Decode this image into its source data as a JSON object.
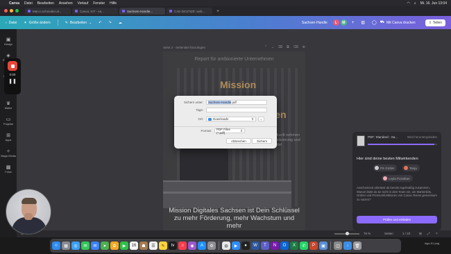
{
  "menubar": {
    "app": "Canva",
    "menus": [
      "Datei",
      "Bearbeiten",
      "Ansehen",
      "Verlauf",
      "Fenster",
      "Hilfe"
    ],
    "clock": "Mi. 16. Jun 13:04"
  },
  "tabs": [
    {
      "label": "Marco.schneider.al..."
    },
    {
      "label": "Canva: KIT - sa..."
    },
    {
      "label": "Sachsen-Handle..."
    },
    {
      "label": "CAE-DIGITIZE: web..."
    }
  ],
  "header": {
    "home": "Datei",
    "resize": "Größe ändern",
    "edit": "Bearbeiten",
    "doc_title": "Sachsen-Handle",
    "avatars": [
      {
        "letter": "L",
        "color": "#e85a7c"
      },
      {
        "letter": "M",
        "color": "#52b788"
      }
    ],
    "print": "Mit Canva drucken",
    "share": "Teilen"
  },
  "sidebar": {
    "items": [
      {
        "icon": "design-icon",
        "label": "Design"
      },
      {
        "icon": "elements-icon",
        "label": "Elemente"
      },
      {
        "icon": "upload-icon",
        "label": "Uploads"
      },
      {
        "icon": "text-icon",
        "label": "Text"
      },
      {
        "icon": "brand-icon",
        "label": "Marke"
      },
      {
        "icon": "projects-icon",
        "label": "Projekte"
      },
      {
        "icon": "apps-icon",
        "label": "Apps"
      },
      {
        "icon": "magic-icon",
        "label": "Magic Media"
      },
      {
        "icon": "photos-icon",
        "label": "Fotos"
      }
    ]
  },
  "recorder": {
    "time": "0:00"
  },
  "canvas": {
    "page_label": "Seite 2 - Seitentitel hinzufügen",
    "report_heading": "Report für ambionierte Unternehmen",
    "mission_word": "Mission",
    "mission_line2": "en",
    "mission_line3": "itten",
    "side_text": "chere Zukunft nehmen aus Digitalisierung und Fördermittel",
    "bottom_text": "Mission Digitales Sachsen ist Dein Schlüssel zu mehr Förderung, mehr Wachstum und mehr"
  },
  "dialog": {
    "save_as_label": "Sichern unter:",
    "filename_selected": "Sachsen-Handle",
    "filename_ext": ".pdf",
    "tags_label": "Tags:",
    "where_label": "Ort:",
    "where_value": "Downloads",
    "format_label": "Format:",
    "format_value": "PDF Files (*.pdf)",
    "cancel": "Abbrechen",
    "save": "Sichern"
  },
  "right_panel": {
    "file_title": "PDF: Standard - Sa...",
    "file_status": "Wird heruntergeladen",
    "progress": 0.96,
    "heading": "Hier sind deine besten Mitwirkenden",
    "chips": [
      {
        "label": "PS GmbH",
        "color": "#c9c9cf"
      },
      {
        "label": "Tanja",
        "color": "#e8715a"
      },
      {
        "label": "Leyla Possibari",
        "color": "#f2a7b5"
      }
    ],
    "description": "Anscheinend arbeitest du bereits regelmäßig zusammen. Warum lädst du sie nicht in dein Team ein, um Markenkits, Ordner und Premiumfunktionen von Canva Teams gemeinsam zu nutzen?",
    "cta": "Prüfen und einladen"
  },
  "statusbar": {
    "zoom": "76 %",
    "pages": "Seiten",
    "page_count": "1 / 23"
  },
  "dock": {
    "apps": [
      {
        "name": "finder-icon",
        "color": "#2d8cf0",
        "glyph": "☺"
      },
      {
        "name": "launchpad-icon",
        "color": "#8a8a92",
        "glyph": "▦"
      },
      {
        "name": "safari-icon",
        "color": "#3aa0f5",
        "glyph": "◎"
      },
      {
        "name": "messages-icon",
        "color": "#34c759",
        "glyph": "✉"
      },
      {
        "name": "mail-icon",
        "color": "#3b82f6",
        "glyph": "✉"
      },
      {
        "name": "maps-icon",
        "color": "#4cb050",
        "glyph": "➤"
      },
      {
        "name": "photos-icon",
        "color": "#f6a623",
        "glyph": "✿"
      },
      {
        "name": "facetime-icon",
        "color": "#2fbf4a",
        "glyph": "▶"
      },
      {
        "name": "calendar-icon",
        "color": "#f5f5f5",
        "glyph": "16"
      },
      {
        "name": "contacts-icon",
        "color": "#a57b4d",
        "glyph": "☗"
      },
      {
        "name": "reminders-icon",
        "color": "#f2f2f2",
        "glyph": "☰"
      },
      {
        "name": "notes-icon",
        "color": "#ffd43b",
        "glyph": "✎"
      },
      {
        "name": "tv-icon",
        "color": "#1c1c1e",
        "glyph": "tv"
      },
      {
        "name": "music-icon",
        "color": "#fa3c4c",
        "glyph": "♫"
      },
      {
        "name": "podcasts-icon",
        "color": "#9b59d0",
        "glyph": "◉"
      },
      {
        "name": "appstore-icon",
        "color": "#1e90ff",
        "glyph": "A"
      },
      {
        "name": "settings-icon",
        "color": "#8e8e93",
        "glyph": "⚙"
      },
      {
        "name": "chrome-icon",
        "color": "#e8e8e8",
        "glyph": "◍"
      },
      {
        "name": "zoom-icon",
        "color": "#2d8cff",
        "glyph": "▶"
      },
      {
        "name": "obs-icon",
        "color": "#222",
        "glyph": "●"
      },
      {
        "name": "word-icon",
        "color": "#2b579a",
        "glyph": "W"
      },
      {
        "name": "teams-icon",
        "color": "#5b5fc7",
        "glyph": "T"
      },
      {
        "name": "onenote-icon",
        "color": "#7719aa",
        "glyph": "N"
      },
      {
        "name": "outlook-icon",
        "color": "#0a64d6",
        "glyph": "O"
      },
      {
        "name": "excel-icon",
        "color": "#1f7a44",
        "glyph": "X"
      },
      {
        "name": "whatsapp-icon",
        "color": "#25d366",
        "glyph": "✆"
      },
      {
        "name": "powerpoint-icon",
        "color": "#c7472d",
        "glyph": "P"
      },
      {
        "name": "preview-icon",
        "color": "#5c8fd6",
        "glyph": "▣"
      },
      {
        "name": "screenshot-icon",
        "color": "#888",
        "glyph": "◫"
      },
      {
        "name": "downloads-icon",
        "color": "#3a8ee6",
        "glyph": "↓"
      },
      {
        "name": "trash-icon",
        "color": "#9a9aa0",
        "glyph": "🗑"
      }
    ]
  },
  "corner_logo": "logo-01.png"
}
